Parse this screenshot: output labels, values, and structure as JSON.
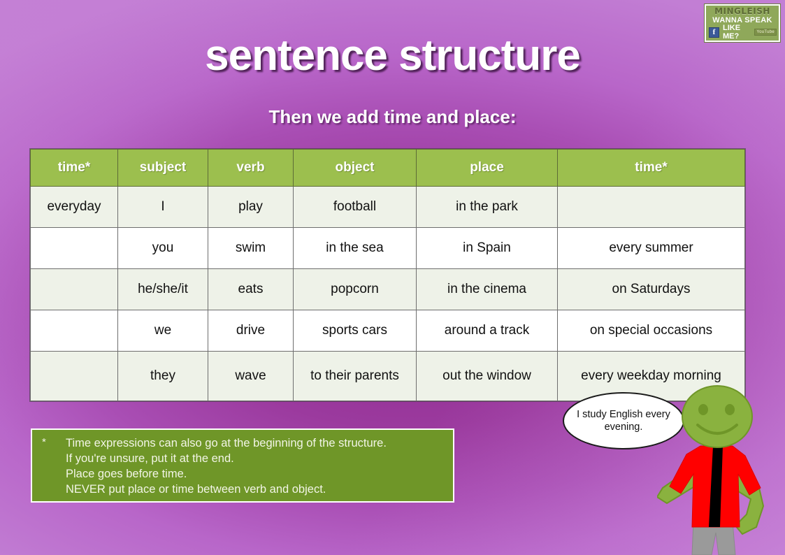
{
  "logo": {
    "brand": "MINGLEISH",
    "line1": "WANNA SPEAK",
    "facebook_icon_letter": "f",
    "line2": "LIKE ME?",
    "badge": "YouTube"
  },
  "title": "sentence structure",
  "subtitle": "Then we add time and place:",
  "table": {
    "headers": [
      "time*",
      "subject",
      "verb",
      "object",
      "place",
      "time*"
    ],
    "rows": [
      [
        "everyday",
        "I",
        "play",
        "football",
        "in the park",
        ""
      ],
      [
        "",
        "you",
        "swim",
        "in the sea",
        "in Spain",
        "every summer"
      ],
      [
        "",
        "he/she/it",
        "eats",
        "popcorn",
        "in the cinema",
        "on Saturdays"
      ],
      [
        "",
        "we",
        "drive",
        "sports cars",
        "around a track",
        "on special occasions"
      ],
      [
        "",
        "they",
        "wave",
        "to their parents",
        "out the window",
        "every weekday morning"
      ]
    ]
  },
  "note": {
    "marker": "*",
    "lines": [
      "Time expressions  can also go at the beginning  of the structure.",
      "If you're unsure,  put it at the end.",
      "Place goes before time.",
      "NEVER  put place or time between verb and object."
    ]
  },
  "speech_bubble": {
    "text": "I study English every evening."
  },
  "colors": {
    "background_purple": "#9b3a9e",
    "header_green": "#9cbf4e",
    "note_green": "#6f9628",
    "row_light": "#eef2e8",
    "row_white": "#ffffff",
    "character_skin": "#8ab23f",
    "character_jacket": "#ff0000",
    "character_pants": "#9a9a9a"
  }
}
